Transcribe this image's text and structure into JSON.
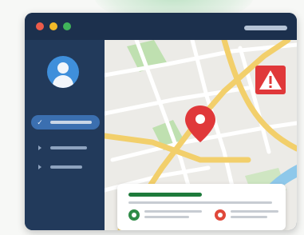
{
  "window": {
    "controls": [
      "close",
      "minimize",
      "maximize"
    ]
  },
  "sidebar": {
    "avatar_icon": "user-avatar-icon",
    "items": [
      {
        "icon": "check-icon",
        "marker": "✓",
        "active": true
      },
      {
        "icon": "arrow-right-icon",
        "active": false
      },
      {
        "icon": "arrow-right-icon",
        "active": false
      }
    ]
  },
  "map": {
    "marker_icon": "map-pin-icon",
    "alert_icon": "warning-triangle-icon",
    "alert_symbol": "!"
  },
  "card": {
    "status_icons": [
      "shield-check-icon",
      "location-alert-icon"
    ]
  },
  "colors": {
    "window_bg": "#1f3553",
    "sidebar_bg": "#223a5b",
    "accent_blue": "#3b6fb0",
    "pin_red": "#e0383a",
    "road_yellow": "#f2cf6b",
    "park_green": "#bfe0b0",
    "water_blue": "#8ec8ea"
  }
}
